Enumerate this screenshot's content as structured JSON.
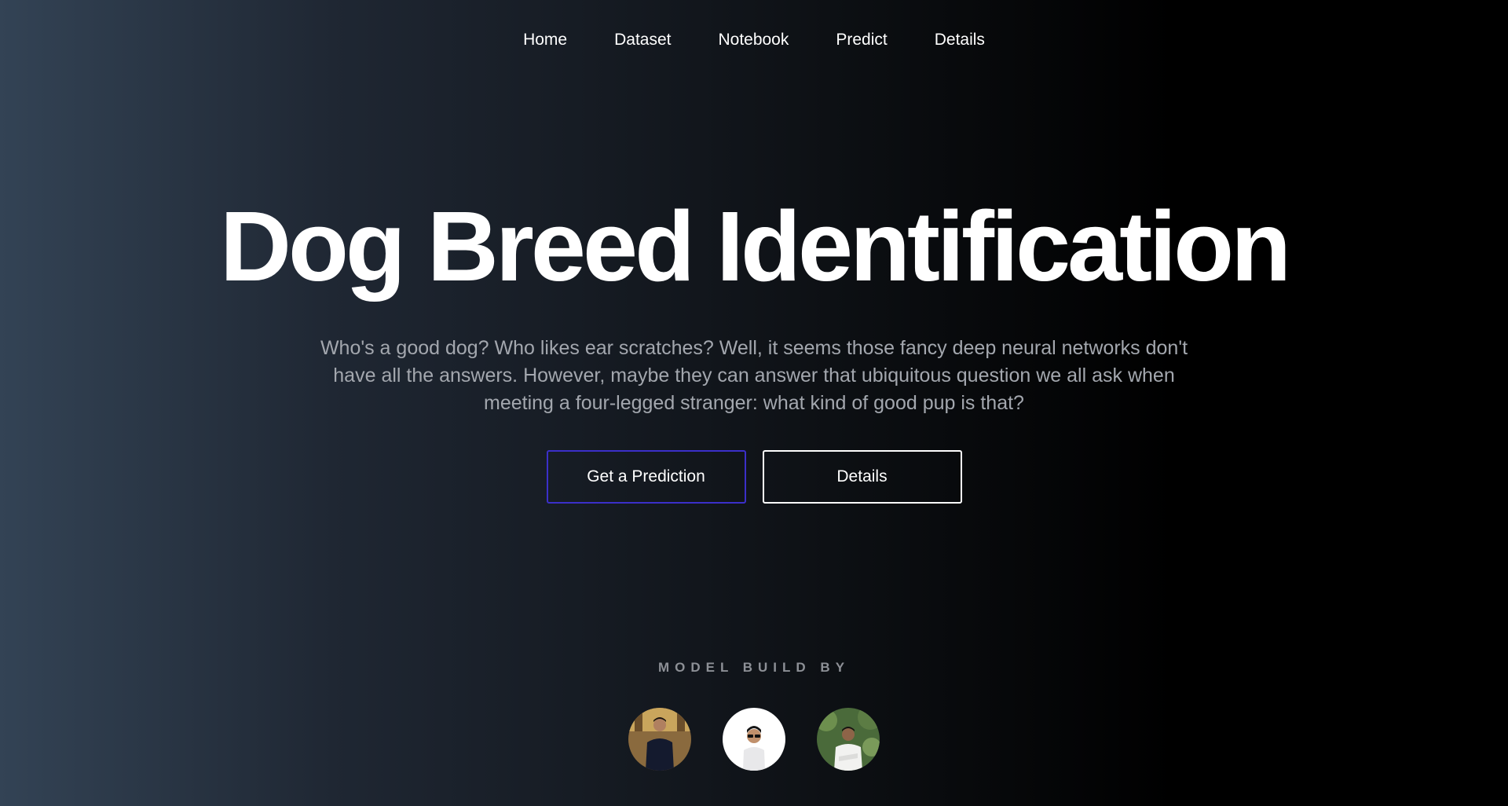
{
  "nav": {
    "items": [
      {
        "label": "Home"
      },
      {
        "label": "Dataset"
      },
      {
        "label": "Notebook"
      },
      {
        "label": "Predict"
      },
      {
        "label": "Details"
      }
    ]
  },
  "hero": {
    "title": "Dog Breed Identification",
    "subtitle": "Who's a good dog? Who likes ear scratches? Well, it seems those fancy deep neural networks don't have all the answers. However, maybe they can answer that ubiquitous question we all ask when meeting a four-legged stranger: what kind of good pup is that?",
    "primary_button": "Get a Prediction",
    "secondary_button": "Details"
  },
  "credits": {
    "label": "MODEL BUILD BY",
    "avatars": [
      {
        "icon": "avatar-photo"
      },
      {
        "icon": "avatar-photo"
      },
      {
        "icon": "avatar-photo"
      }
    ]
  },
  "colors": {
    "primary_border": "#3b2fc9",
    "secondary_border": "#ffffff",
    "subtitle_text": "#a3a7ae"
  }
}
